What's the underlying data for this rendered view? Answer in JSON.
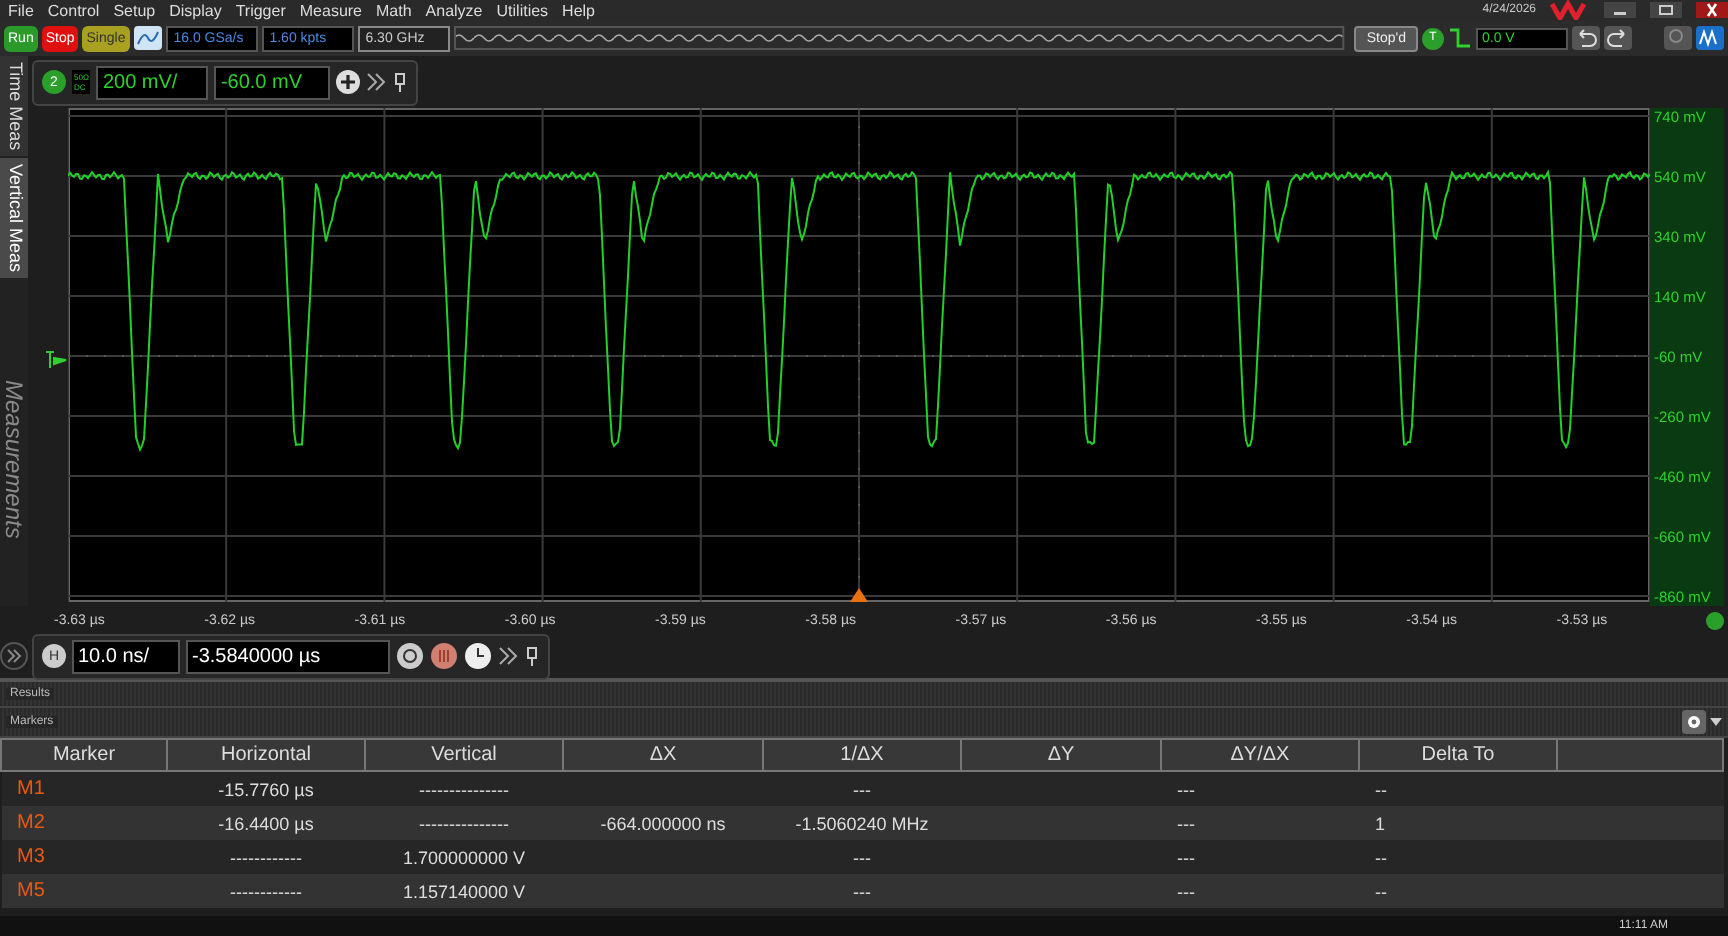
{
  "menu": [
    "File",
    "Control",
    "Setup",
    "Display",
    "Trigger",
    "Measure",
    "Math",
    "Analyze",
    "Utilities",
    "Help"
  ],
  "date": "4/24/2026",
  "acquisition": {
    "buttons": [
      {
        "label": "Run",
        "kind": "run"
      },
      {
        "label": "Stop",
        "kind": "stop"
      },
      {
        "label": "Single",
        "kind": "single"
      }
    ],
    "sample_rate": "16.0 GSa/s",
    "memory_depth": "1.60 kpts",
    "bandwidth": "6.30 GHz",
    "status": "Stop'd"
  },
  "trigger": {
    "badge": "T",
    "value": "0.0 V"
  },
  "side_tabs": [
    {
      "label": "Time Meas",
      "selected": false
    },
    {
      "label": "Vertical Meas",
      "selected": true
    }
  ],
  "side_panel_label": "Measurements",
  "channel": {
    "number": "2",
    "coupling_top": "50Ω",
    "coupling_bottom": "DC",
    "scale": "200 mV/",
    "offset": "-60.0 mV"
  },
  "plot": {
    "y_labels": [
      "740 mV",
      "540 mV",
      "340 mV",
      "140 mV",
      "-60 mV",
      "-260 mV",
      "-460 mV",
      "-660 mV",
      "-860 mV"
    ],
    "x_labels": [
      "-3.63 µs",
      "-3.62 µs",
      "-3.61 µs",
      "-3.60 µs",
      "-3.59 µs",
      "-3.58 µs",
      "-3.57 µs",
      "-3.56 µs",
      "-3.55 µs",
      "-3.54 µs",
      "-3.53 µs"
    ]
  },
  "horizontal": {
    "badge": "H",
    "scale": "10.0 ns/",
    "position": "-3.5840000 µs"
  },
  "results_title": "Results",
  "markers": {
    "title": "Markers",
    "columns": [
      "Marker",
      "Horizontal",
      "Vertical",
      "ΔX",
      "1/ΔX",
      "ΔY",
      "ΔY/ΔX",
      "Delta To"
    ],
    "rows": [
      {
        "cells": [
          "M1",
          "-15.7760 µs",
          "---------------",
          null,
          "---",
          null,
          "---",
          "--"
        ]
      },
      {
        "cells": [
          "M2",
          "-16.4400 µs",
          "---------------",
          "-664.000000 ns",
          "-1.5060240 MHz",
          null,
          "---",
          "1"
        ]
      },
      {
        "cells": [
          "M3",
          "------------",
          "1.700000000 V",
          null,
          "---",
          null,
          "---",
          "--"
        ]
      },
      {
        "cells": [
          "M5",
          "------------",
          "1.157140000 V",
          null,
          "---",
          null,
          "---",
          "--"
        ]
      }
    ]
  },
  "taskbar": {
    "clock": "11:11 AM"
  }
}
